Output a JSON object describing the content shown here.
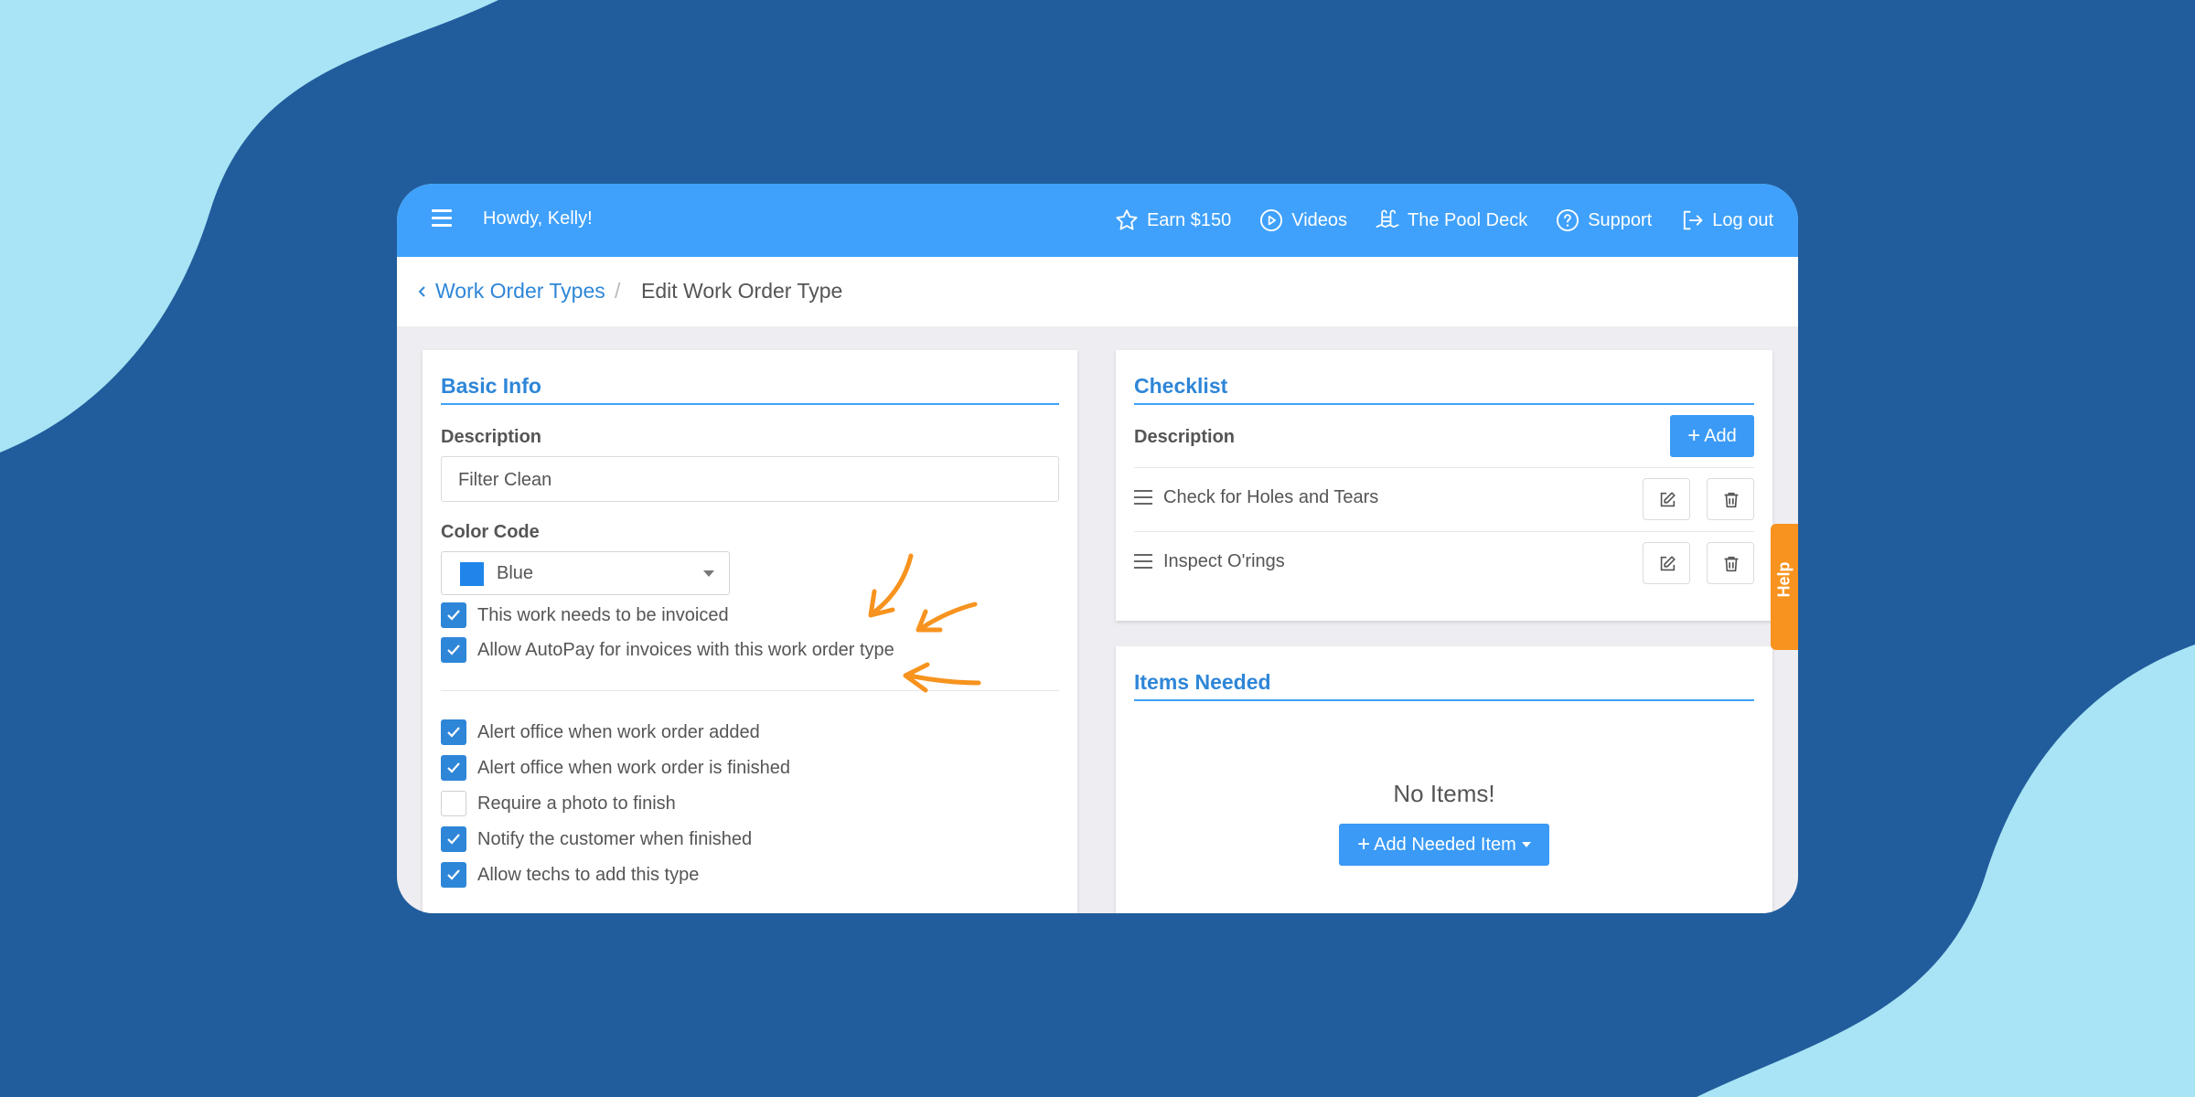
{
  "header": {
    "greeting": "Howdy, Kelly!",
    "nav": [
      {
        "label": "Earn $150",
        "icon": "star-icon"
      },
      {
        "label": "Videos",
        "icon": "play-circle-icon"
      },
      {
        "label": "The Pool Deck",
        "icon": "pool-ladder-icon"
      },
      {
        "label": "Support",
        "icon": "question-circle-icon"
      },
      {
        "label": "Log out",
        "icon": "logout-icon"
      }
    ]
  },
  "breadcrumb": {
    "parent": "Work Order Types",
    "separator": "/",
    "current": "Edit Work Order Type"
  },
  "basic_info": {
    "title": "Basic Info",
    "description_label": "Description",
    "description_value": "Filter Clean",
    "color_label": "Color Code",
    "color_value": "Blue",
    "color_hex": "#1f85ea",
    "checks_group1": [
      {
        "label": "This work needs to be invoiced",
        "checked": true
      },
      {
        "label": "Allow AutoPay for invoices with this work order type",
        "checked": true
      }
    ],
    "checks_group2": [
      {
        "label": "Alert office when work order added",
        "checked": true
      },
      {
        "label": "Alert office when work order is finished",
        "checked": true
      },
      {
        "label": "Require a photo to finish",
        "checked": false
      },
      {
        "label": "Notify the customer when finished",
        "checked": true
      },
      {
        "label": "Allow techs to add this type",
        "checked": true
      }
    ]
  },
  "checklist": {
    "title": "Checklist",
    "column_label": "Description",
    "add_label": "Add",
    "items": [
      "Check for Holes and Tears",
      "Inspect O'rings"
    ]
  },
  "items_needed": {
    "title": "Items Needed",
    "empty_text": "No Items!",
    "add_label": "Add Needed Item"
  },
  "help_tab": "Help",
  "colors": {
    "background": "#215d9c",
    "blob": "#a8e4f5",
    "topbar": "#3fa1fb",
    "accent": "#2e86d8",
    "annotation": "#f7931e"
  }
}
